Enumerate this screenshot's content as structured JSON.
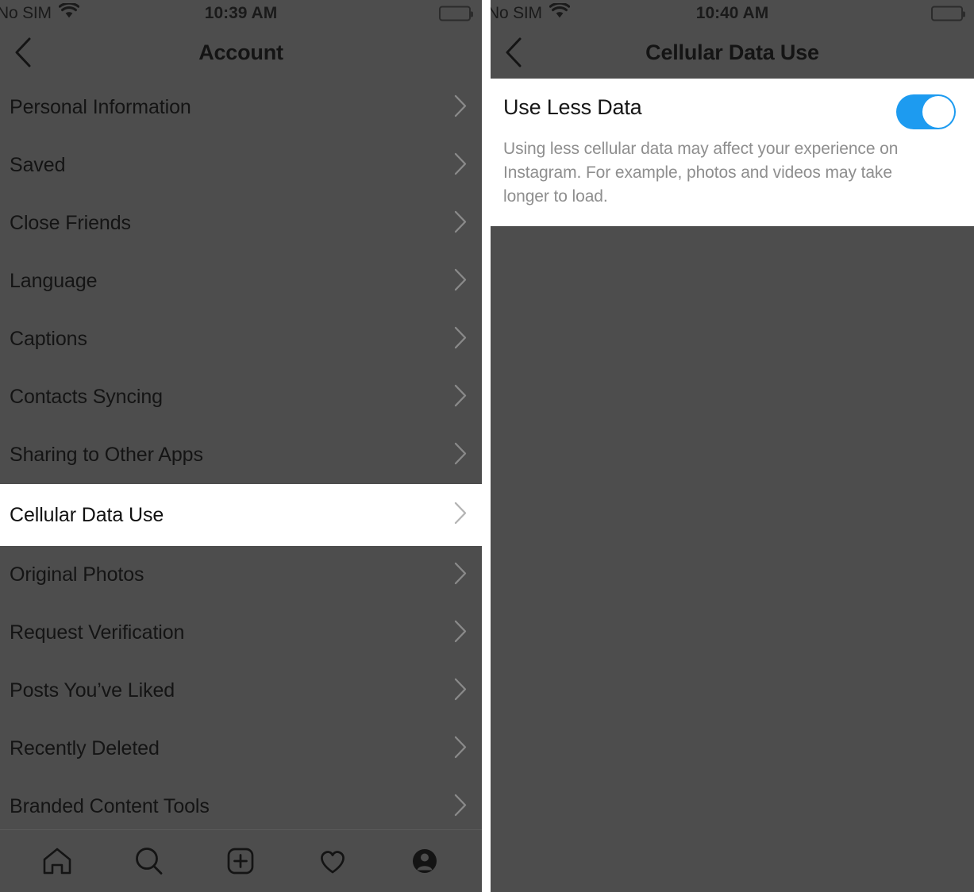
{
  "left_screen": {
    "status_bar": {
      "carrier": "No SIM",
      "wifi_icon": "wifi-icon",
      "time": "10:39 AM",
      "battery_icon": "battery-icon"
    },
    "nav": {
      "back_icon": "chevron-left-icon",
      "title": "Account"
    },
    "list_items": [
      {
        "label": "Personal Information",
        "chevron": "chevron-right-icon",
        "highlighted": false
      },
      {
        "label": "Saved",
        "chevron": "chevron-right-icon",
        "highlighted": false
      },
      {
        "label": "Close Friends",
        "chevron": "chevron-right-icon",
        "highlighted": false
      },
      {
        "label": "Language",
        "chevron": "chevron-right-icon",
        "highlighted": false
      },
      {
        "label": "Captions",
        "chevron": "chevron-right-icon",
        "highlighted": false
      },
      {
        "label": "Contacts Syncing",
        "chevron": "chevron-right-icon",
        "highlighted": false
      },
      {
        "label": "Sharing to Other Apps",
        "chevron": "chevron-right-icon",
        "highlighted": false
      },
      {
        "label": "Cellular Data Use",
        "chevron": "chevron-right-icon",
        "highlighted": true
      },
      {
        "label": "Original Photos",
        "chevron": "chevron-right-icon",
        "highlighted": false
      },
      {
        "label": "Request Verification",
        "chevron": "chevron-right-icon",
        "highlighted": false
      },
      {
        "label": "Posts You’ve Liked",
        "chevron": "chevron-right-icon",
        "highlighted": false
      },
      {
        "label": "Recently Deleted",
        "chevron": "chevron-right-icon",
        "highlighted": false
      },
      {
        "label": "Branded Content Tools",
        "chevron": "chevron-right-icon",
        "highlighted": false
      }
    ],
    "tab_bar": [
      {
        "name": "home-icon"
      },
      {
        "name": "search-icon"
      },
      {
        "name": "add-post-icon"
      },
      {
        "name": "activity-heart-icon"
      },
      {
        "name": "profile-icon"
      }
    ]
  },
  "right_screen": {
    "status_bar": {
      "carrier": "No SIM",
      "wifi_icon": "wifi-icon",
      "time": "10:40 AM",
      "battery_icon": "battery-icon"
    },
    "nav": {
      "back_icon": "chevron-left-icon",
      "title": "Cellular Data Use"
    },
    "setting": {
      "title": "Use Less Data",
      "description": "Using less cellular data may affect your experience on Instagram. For example, photos and videos may take longer to load.",
      "toggle_state": "on"
    }
  },
  "colors": {
    "dimmed_background": "#4d4d4d",
    "card_background": "#ffffff",
    "toggle_on": "#1d9bf0",
    "primary_text": "#141414",
    "secondary_text": "#8e8e8e"
  }
}
